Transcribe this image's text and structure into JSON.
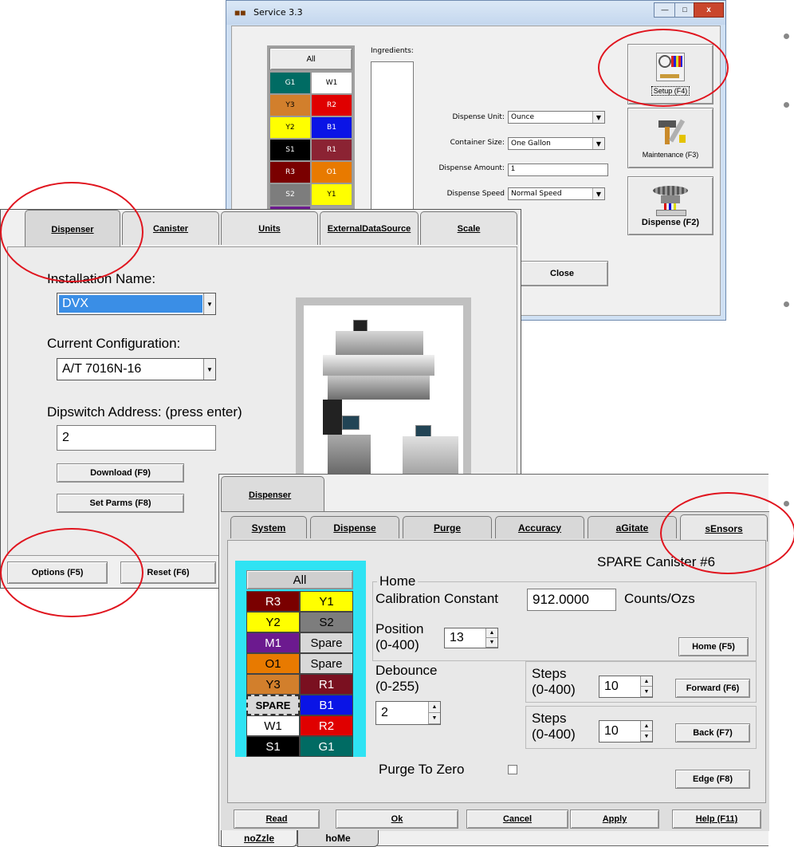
{
  "service_window": {
    "title": "Service 3.3",
    "colorant_all_label": "All",
    "colorants": [
      {
        "label": "G1",
        "bg": "#006b63",
        "fg": "#ffffff"
      },
      {
        "label": "W1",
        "bg": "#ffffff",
        "fg": "#000000"
      },
      {
        "label": "Y3",
        "bg": "#d27f2c",
        "fg": "#000000"
      },
      {
        "label": "R2",
        "bg": "#e00000",
        "fg": "#ffffff"
      },
      {
        "label": "Y2",
        "bg": "#ffff00",
        "fg": "#000000"
      },
      {
        "label": "B1",
        "bg": "#0a14e6",
        "fg": "#ffffff"
      },
      {
        "label": "S1",
        "bg": "#000000",
        "fg": "#ffffff"
      },
      {
        "label": "R1",
        "bg": "#8b2333",
        "fg": "#ffffff"
      },
      {
        "label": "R3",
        "bg": "#7a0000",
        "fg": "#ffffff"
      },
      {
        "label": "O1",
        "bg": "#e87a00",
        "fg": "#ffffff"
      },
      {
        "label": "S2",
        "bg": "#7d7d7d",
        "fg": "#ffffff"
      },
      {
        "label": "Y1",
        "bg": "#ffff00",
        "fg": "#000000"
      }
    ],
    "ingredients_label": "Ingredients:",
    "dispense_unit_label": "Dispense Unit:",
    "dispense_unit_value": "Ounce",
    "container_size_label": "Container Size:",
    "container_size_value": "One Gallon",
    "dispense_amount_label": "Dispense Amount:",
    "dispense_amount_value": "1",
    "dispense_speed_label": "Dispense Speed",
    "dispense_speed_value": "Normal Speed",
    "setup_label": "Setup (F4)",
    "maintenance_label": "Maintenance (F3)",
    "dispense_label": "Dispense (F2)",
    "close_label": "Close"
  },
  "setup_window": {
    "tabs": [
      "Dispenser",
      "Canister",
      "Units",
      "ExternalDataSource",
      "Scale"
    ],
    "installation_name_label": "Installation Name:",
    "installation_name_value": "DVX",
    "current_config_label": "Current Configuration:",
    "current_config_value": "A/T 7016N-16",
    "dipswitch_label": "Dipswitch Address: (press enter)",
    "dipswitch_value": "2",
    "download_label": "Download (F9)",
    "set_parms_label": "Set Parms (F8)",
    "options_label": "Options (F5)",
    "reset_label": "Reset (F6)"
  },
  "maint_window": {
    "outer_tab": "Dispenser",
    "tabs": [
      "System",
      "Dispense",
      "Purge",
      "Accuracy",
      "aGitate",
      "sEnsors"
    ],
    "canister_title": "SPARE Canister #6",
    "all_label": "All",
    "grid": [
      {
        "label": "R3",
        "bg": "#7a0000",
        "fg": "#ffffff"
      },
      {
        "label": "Y1",
        "bg": "#ffff00",
        "fg": "#000000"
      },
      {
        "label": "Y2",
        "bg": "#ffff00",
        "fg": "#000000"
      },
      {
        "label": "S2",
        "bg": "#7d7d7d",
        "fg": "#000000"
      },
      {
        "label": "M1",
        "bg": "#6c1a8f",
        "fg": "#ffffff"
      },
      {
        "label": "Spare",
        "bg": "#d8d8d8",
        "fg": "#000000"
      },
      {
        "label": "O1",
        "bg": "#e87a00",
        "fg": "#000000"
      },
      {
        "label": "Spare",
        "bg": "#d8d8d8",
        "fg": "#000000"
      },
      {
        "label": "Y3",
        "bg": "#d27f2c",
        "fg": "#000000"
      },
      {
        "label": "R1",
        "bg": "#7a1020",
        "fg": "#ffffff"
      },
      {
        "label": "SPARE",
        "bg": "#d8d8d8",
        "fg": "#000000"
      },
      {
        "label": "B1",
        "bg": "#0a14e6",
        "fg": "#ffffff"
      },
      {
        "label": "W1",
        "bg": "#ffffff",
        "fg": "#000000"
      },
      {
        "label": "R2",
        "bg": "#e00000",
        "fg": "#ffffff"
      },
      {
        "label": "S1",
        "bg": "#000000",
        "fg": "#ffffff"
      },
      {
        "label": "G1",
        "bg": "#006b63",
        "fg": "#ffffff"
      }
    ],
    "home_group_label": "Home",
    "cal_constant_label": "Calibration Constant",
    "cal_constant_value": "912.0000",
    "cal_units": "Counts/Ozs",
    "position_label": "Position",
    "position_range": "(0-400)",
    "position_value": "13",
    "home_button": "Home (F5)",
    "debounce_label": "Debounce",
    "debounce_range": "(0-255)",
    "debounce_value": "2",
    "steps_label": "Steps",
    "steps_range": "(0-400)",
    "forward_steps_value": "10",
    "forward_button": "Forward (F6)",
    "back_steps_value": "10",
    "back_button": "Back (F7)",
    "purge_to_zero_label": "Purge To Zero",
    "edge_button": "Edge (F8)",
    "read_label": "Read",
    "ok_label": "Ok",
    "cancel_label": "Cancel",
    "apply_label": "Apply",
    "help_label": "Help (F11)",
    "bottom_tabs": [
      "noZzle",
      "hoMe"
    ]
  }
}
